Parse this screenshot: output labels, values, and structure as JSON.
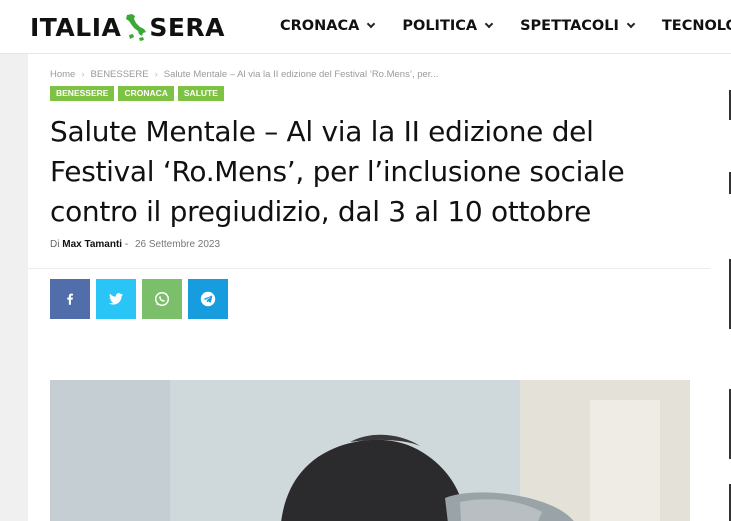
{
  "header": {
    "logo": {
      "part1": "ITALIA",
      "part2": "SERA"
    },
    "nav": [
      {
        "label": "CRONACA"
      },
      {
        "label": "POLITICA"
      },
      {
        "label": "SPETTACOLI"
      },
      {
        "label": "TECNOLOG"
      }
    ]
  },
  "breadcrumb": {
    "items": [
      "Home",
      "BENESSERE",
      "Salute Mentale – Al via la II edizione del Festival ‘Ro.Mens’, per..."
    ]
  },
  "tags": [
    "BENESSERE",
    "CRONACA",
    "SALUTE"
  ],
  "article": {
    "title": "Salute Mentale – Al via la II edizione del Festival ‘Ro.Mens’, per l’inclusione sociale contro il pregiudizio, dal 3 al 10 ottobre",
    "by_prefix": "Di",
    "author": "Max Tamanti",
    "author_sep": "-",
    "date": "26 Settembre 2023"
  },
  "colors": {
    "tag_green": "#7dc242",
    "facebook": "#516eab",
    "twitter": "#29c5f6",
    "whatsapp": "#7bbf6a",
    "telegram": "#179cde"
  },
  "share_icons": [
    "facebook-icon",
    "twitter-icon",
    "whatsapp-icon",
    "telegram-icon"
  ]
}
